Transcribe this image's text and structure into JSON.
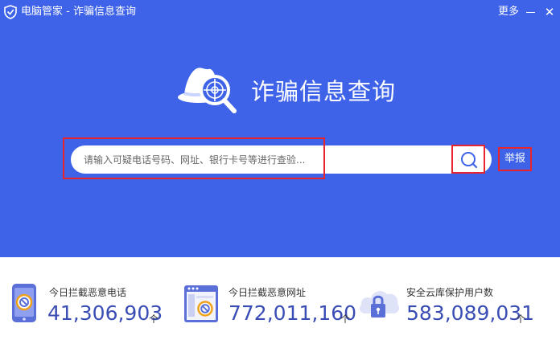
{
  "titlebar": {
    "app_title": "电脑管家 - 诈骗信息查询",
    "more_label": "更多",
    "close_glyph": "✕"
  },
  "hero": {
    "title": "诈骗信息查询",
    "background_color": "#3e63e8"
  },
  "search": {
    "placeholder": "请输入可疑电话号码、网址、银行卡号等进行查验...",
    "value": "",
    "report_label": "举报",
    "highlight_color": "#e8242f"
  },
  "stats": [
    {
      "label": "今日拦截恶意电话",
      "value": "41,306,903",
      "unit": "个",
      "icon": "blocked-phone-icon"
    },
    {
      "label": "今日拦截恶意网址",
      "value": "772,011,160",
      "unit": "个",
      "icon": "blocked-website-icon"
    },
    {
      "label": "安全云库保护用户数",
      "value": "583,089,031",
      "unit": "个",
      "icon": "cloud-lock-icon"
    }
  ]
}
